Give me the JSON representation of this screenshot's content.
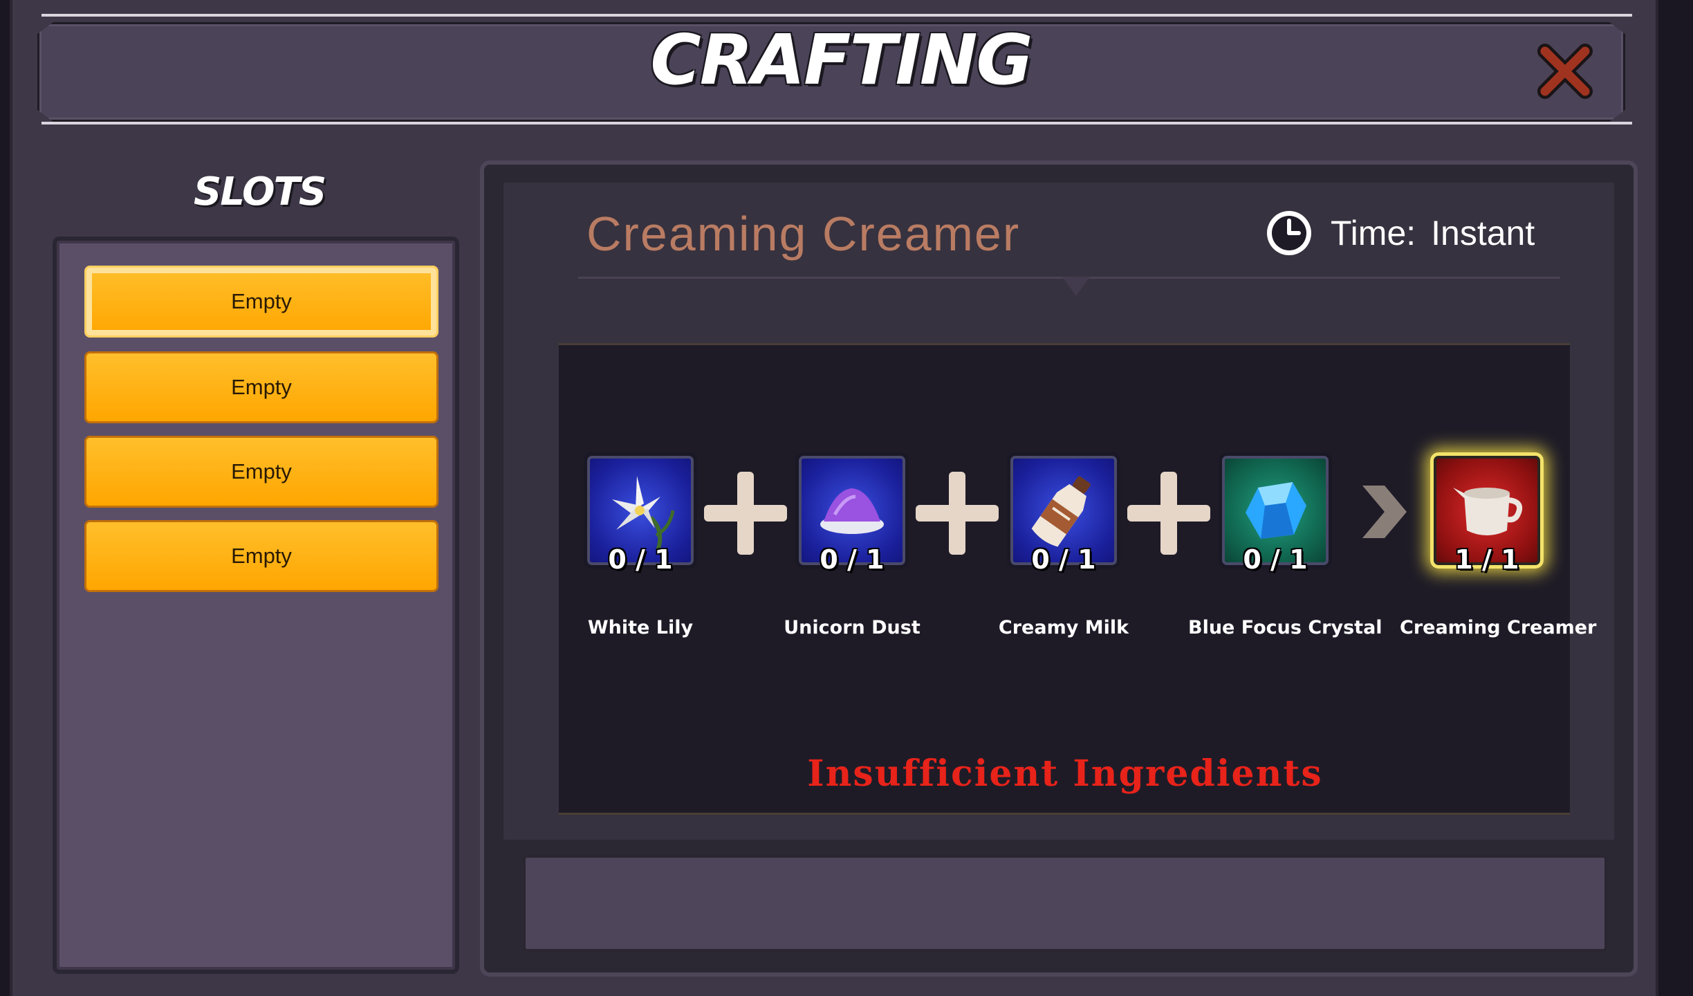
{
  "window": {
    "title": "CRAFTING",
    "close_icon": "close-x-icon"
  },
  "slots": {
    "title": "SLOTS",
    "items": [
      {
        "label": "Empty",
        "selected": true
      },
      {
        "label": "Empty",
        "selected": false
      },
      {
        "label": "Empty",
        "selected": false
      },
      {
        "label": "Empty",
        "selected": false
      }
    ]
  },
  "recipe": {
    "name": "Creaming Creamer",
    "time_label": "Time:",
    "time_value": "Instant",
    "time_icon": "clock-icon",
    "ingredients": [
      {
        "name": "White Lily",
        "count": "0 / 1",
        "icon": "white-lily-icon",
        "bg": "#1a1f9a"
      },
      {
        "name": "Unicorn Dust",
        "count": "0 / 1",
        "icon": "unicorn-dust-icon",
        "bg": "#1a1f9a"
      },
      {
        "name": "Creamy Milk",
        "count": "0 / 1",
        "icon": "milk-bottle-icon",
        "bg": "#1a1f9a"
      },
      {
        "name": "Blue Focus Crystal",
        "count": "0 / 1",
        "icon": "crystal-icon",
        "bg": "#0f5f4a"
      }
    ],
    "result": {
      "name": "Creaming Creamer",
      "count": "1 / 1",
      "icon": "creamer-jug-icon",
      "bg": "#8e1010"
    },
    "status": "Insufficient Ingredients"
  },
  "description": ""
}
